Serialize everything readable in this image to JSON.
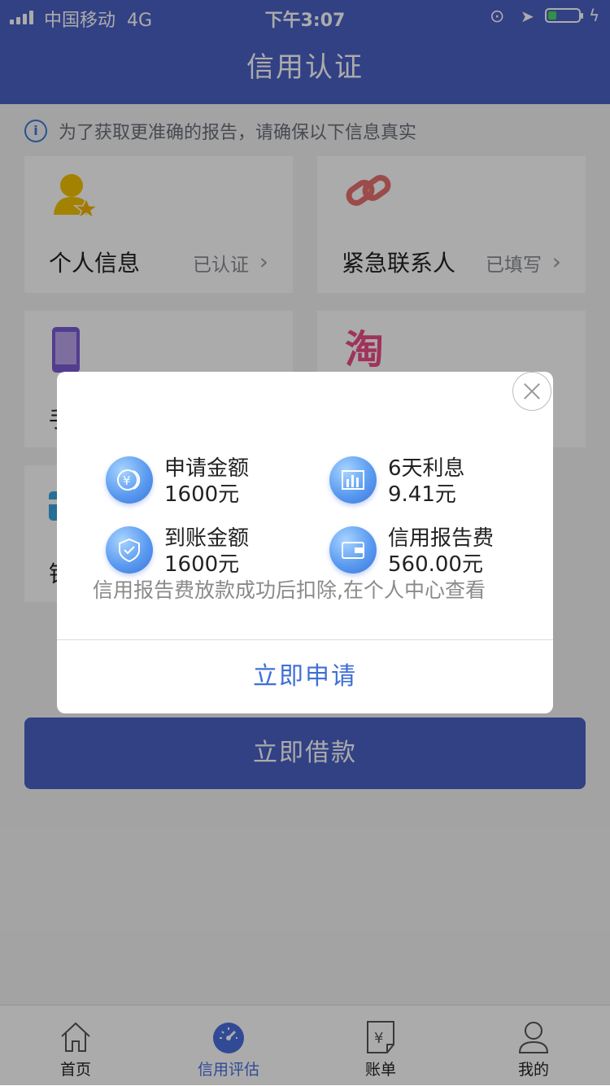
{
  "status_bar": {
    "carrier": "中国移动",
    "network": "4G",
    "time": "下午3:07"
  },
  "header": {
    "title": "信用认证"
  },
  "notice": {
    "text": "为了获取更准确的报告，请确保以下信息真实"
  },
  "cards": [
    {
      "label": "个人信息",
      "status": "已认证"
    },
    {
      "label": "紧急联系人",
      "status": "已填写"
    }
  ],
  "hidden_card_fragments": {
    "phone": "手",
    "bank": "银"
  },
  "borrow_button": {
    "label": "立即借款"
  },
  "modal": {
    "items": [
      {
        "title": "申请金额",
        "value": "1600元",
        "icon": "yen-coin-icon"
      },
      {
        "title": "6天利息",
        "value": "9.41元",
        "icon": "bar-chart-icon"
      },
      {
        "title": "到账金额",
        "value": "1600元",
        "icon": "shield-check-icon"
      },
      {
        "title": "信用报告费",
        "value": "560.00元",
        "icon": "wallet-icon"
      }
    ],
    "note": "信用报告费放款成功后扣除,在个人中心查看",
    "apply_label": "立即申请"
  },
  "tabs": [
    {
      "label": "首页",
      "icon": "home-icon",
      "active": false
    },
    {
      "label": "信用评估",
      "icon": "speedometer-icon",
      "active": true
    },
    {
      "label": "账单",
      "icon": "bill-icon",
      "active": false
    },
    {
      "label": "我的",
      "icon": "user-icon",
      "active": false
    }
  ],
  "colors": {
    "brand": "#4b62c5",
    "active_tab": "#4a6fe0",
    "apply_text": "#3f6fd6"
  }
}
